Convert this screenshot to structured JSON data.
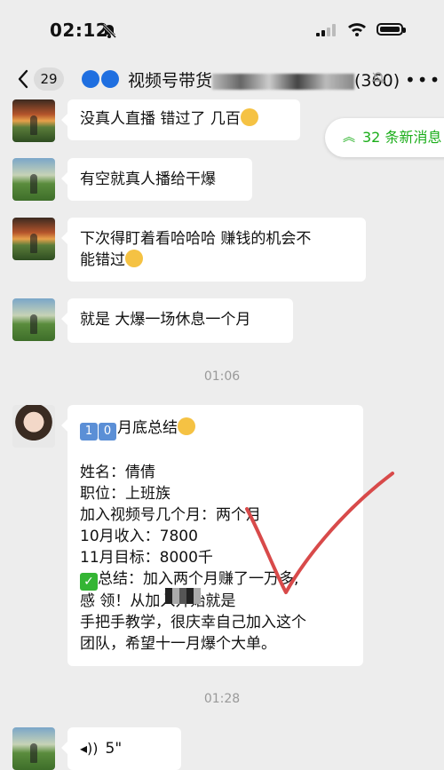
{
  "status_bar": {
    "time": "02:12"
  },
  "nav": {
    "unread_count": "29",
    "group_title_prefix": "视频号带货",
    "group_member_count": "(360)"
  },
  "new_messages": {
    "label": "32 条新消息",
    "arrows": "≈"
  },
  "messages": [
    {
      "text": "没真人直播 错过了 几百"
    },
    {
      "text": "有空就真人播给干爆"
    },
    {
      "line1": "下次得盯着看哈哈哈 赚钱的机会不",
      "line2": "能错过"
    },
    {
      "text": "就是 大爆一场休息一个月"
    }
  ],
  "timestamps": [
    "01:06",
    "01:28"
  ],
  "summary": {
    "heading_digits": [
      "1",
      "0"
    ],
    "heading_text": "月底总结",
    "name": "姓名：倩倩",
    "job": "职位：上班族",
    "months": "加入视频号几个月：两个月",
    "income": "10月收入：7800",
    "target": "11月目标：8000千",
    "conclusion_1": "总结：加入两个月赚了一万多,",
    "conclusion_2": "感      领！从加入开始就是",
    "conclusion_3": "手把手教学，很庆幸自己加入这个",
    "conclusion_4": "团队，希望十一月爆个大单。"
  },
  "voice_message": {
    "duration": "5\""
  }
}
